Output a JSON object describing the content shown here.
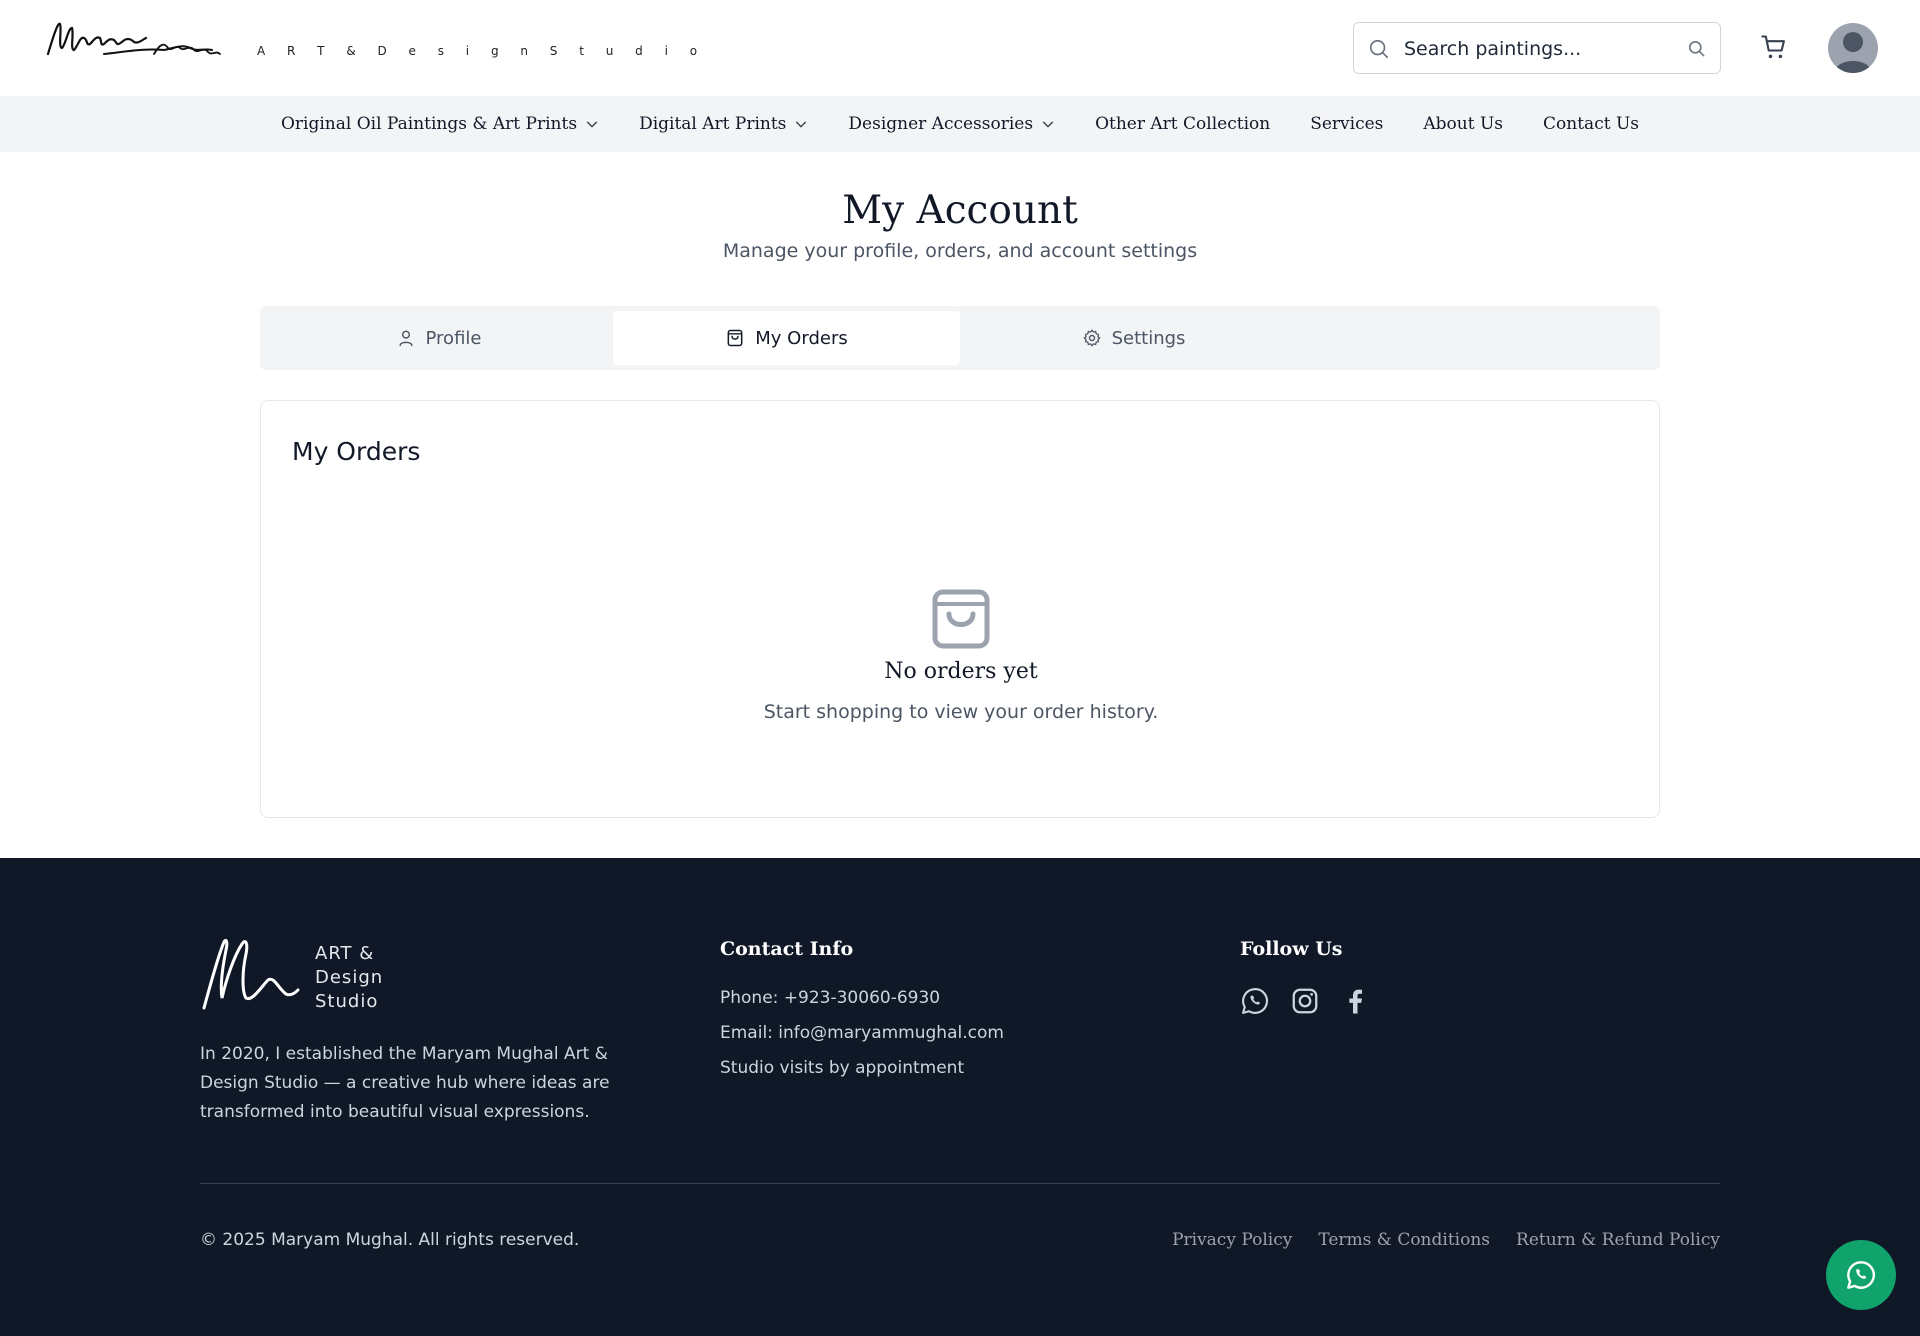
{
  "header": {
    "tagline": "A R T  &  D e s i g n  S t u d i o",
    "search_placeholder": "Search paintings..."
  },
  "nav": [
    {
      "label": "Original Oil Paintings & Art Prints",
      "dropdown": true
    },
    {
      "label": "Digital Art Prints",
      "dropdown": true
    },
    {
      "label": "Designer Accessories",
      "dropdown": true
    },
    {
      "label": "Other Art Collection",
      "dropdown": false
    },
    {
      "label": "Services",
      "dropdown": false
    },
    {
      "label": "About Us",
      "dropdown": false
    },
    {
      "label": "Contact Us",
      "dropdown": false
    }
  ],
  "page": {
    "title": "My Account",
    "subtitle": "Manage your profile, orders, and account settings"
  },
  "tabs": [
    {
      "label": "Profile",
      "icon": "user-icon",
      "active": false
    },
    {
      "label": "My Orders",
      "icon": "shopping-bag-icon",
      "active": true
    },
    {
      "label": "Settings",
      "icon": "gear-icon",
      "active": false
    }
  ],
  "orders": {
    "title": "My Orders",
    "empty_title": "No orders yet",
    "empty_text": "Start shopping to view your order history."
  },
  "footer": {
    "brand_lines": [
      "ART &",
      "Design",
      "Studio"
    ],
    "about": "In 2020, I established the Maryam Mughal Art & Design Studio — a creative hub where ideas are transformed into beautiful visual expressions.",
    "contact_heading": "Contact Info",
    "phone": "Phone: +923-30060-6930",
    "email": "Email: info@maryammughal.com",
    "visits": "Studio visits by appointment",
    "follow_heading": "Follow Us",
    "copyright": "© 2025 Maryam Mughal. All rights reserved.",
    "links": [
      "Privacy Policy",
      "Terms & Conditions",
      "Return & Refund Policy"
    ]
  },
  "colors": {
    "footer_bg": "#101828",
    "whatsapp_green": "#10a36b",
    "nav_bg": "#f3f4f6"
  }
}
